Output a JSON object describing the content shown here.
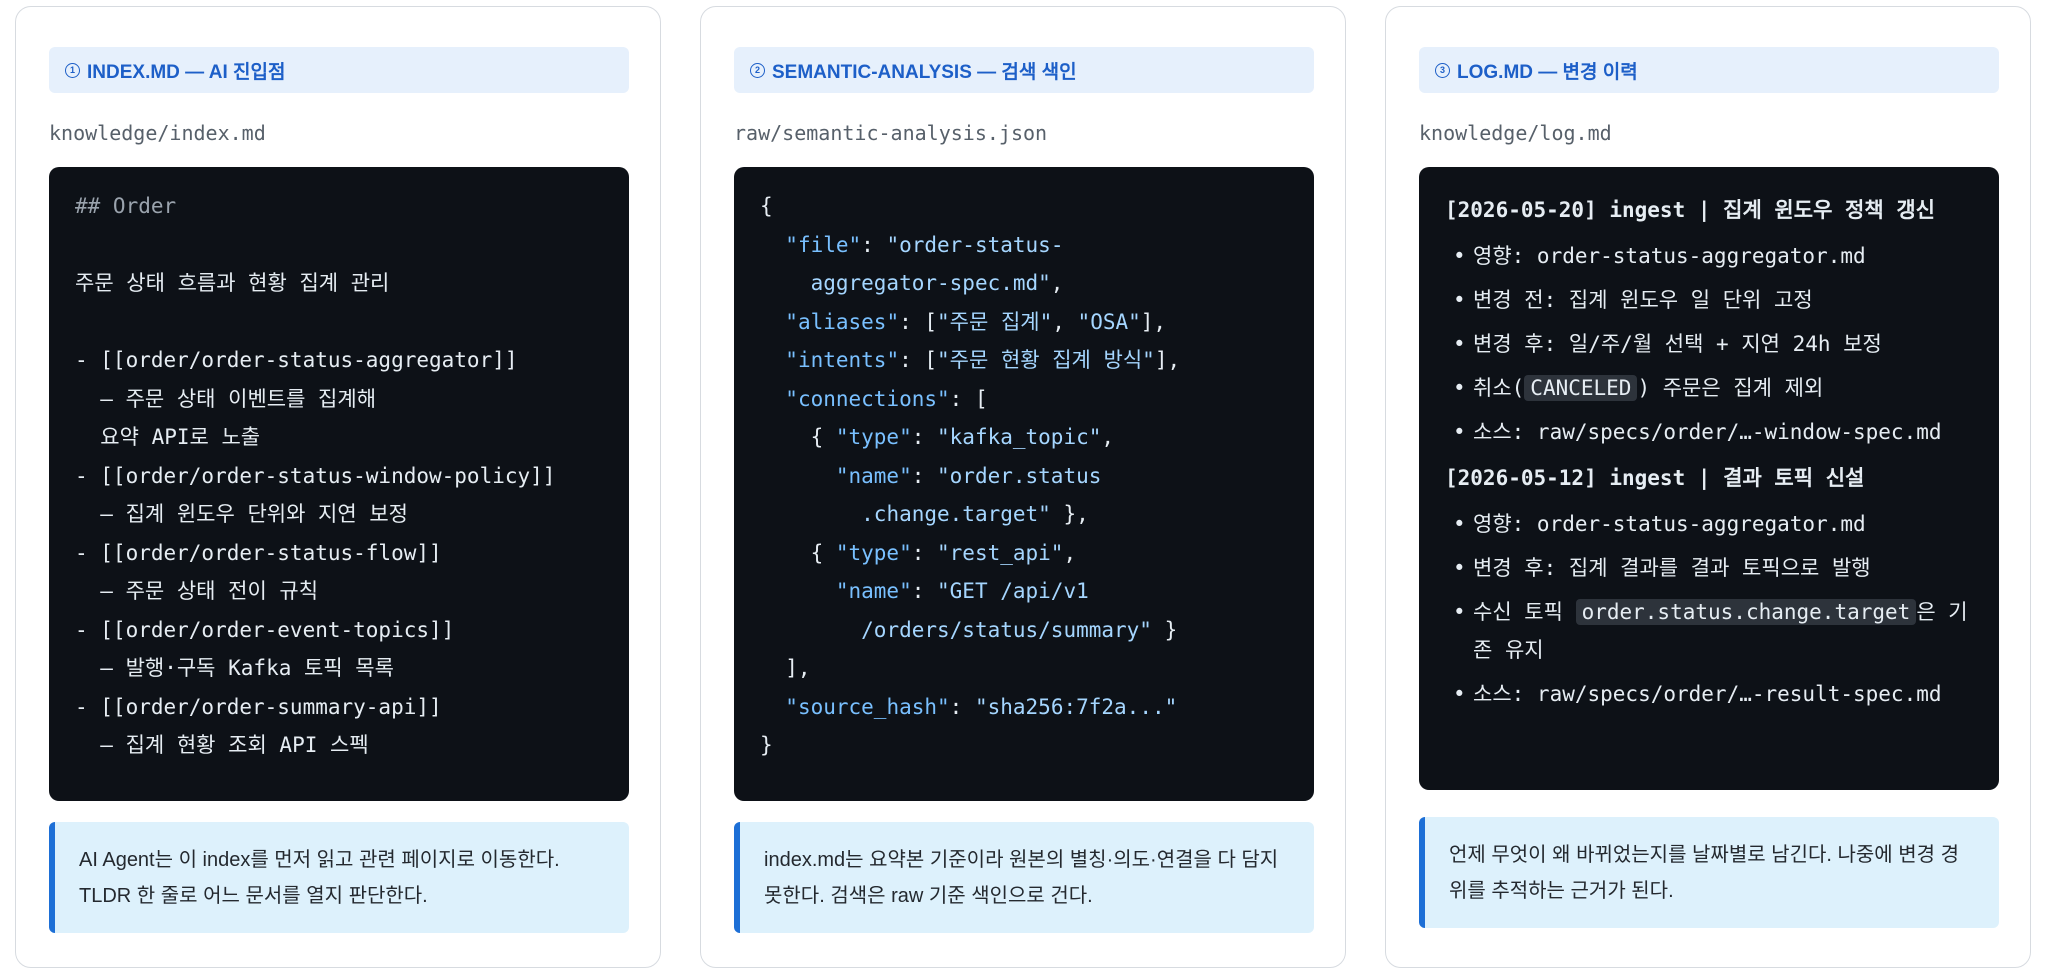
{
  "cards": [
    {
      "num": "1",
      "title": "INDEX.MD — AI 진입점",
      "path": "knowledge/index.md",
      "lines": [
        "## Order",
        "",
        "주문 상태 흐름과 현황 집계 관리",
        "",
        "- [[order/order-status-aggregator]]",
        "  — 주문 상태 이벤트를 집계해",
        "  요약 API로 노출",
        "- [[order/order-status-window-policy]]",
        "  — 집계 윈도우 단위와 지연 보정",
        "- [[order/order-status-flow]]",
        "  — 주문 상태 전이 규칙",
        "- [[order/order-event-topics]]",
        "  — 발행·구독 Kafka 토픽 목록",
        "- [[order/order-summary-api]]",
        "  — 집계 현황 조회 API 스펙"
      ],
      "note": "AI Agent는 이 index를 먼저 읽고 관련 페이지로 이동한다. TLDR 한 줄로 어느 문서를 열지 판단한다."
    },
    {
      "num": "2",
      "title": "SEMANTIC-ANALYSIS — 검색 색인",
      "path": "raw/semantic-analysis.json",
      "json": {
        "l1": "{",
        "file_key": "\"file\"",
        "file_val_a": "\"order-status-",
        "file_val_b": "aggregator-spec.md\"",
        "aliases_key": "\"aliases\"",
        "aliases_a": "\"주문 집계\"",
        "aliases_b": "\"OSA\"",
        "intents_key": "\"intents\"",
        "intents_a": "\"주문 현황 집계 방식\"",
        "connections_key": "\"connections\"",
        "type_key": "\"type\"",
        "type1": "\"kafka_topic\"",
        "name_key": "\"name\"",
        "name1_a": "\"order.status",
        "name1_b": ".change.target\"",
        "type2": "\"rest_api\"",
        "name2_a": "\"GET /api/v1",
        "name2_b": "/orders/status/summary\"",
        "hash_key": "\"source_hash\"",
        "hash_val": "\"sha256:7f2a...\"",
        "close": "}"
      },
      "note": "index.md는 요약본 기준이라 원본의 별칭·의도·연결을 다 담지 못한다. 검색은 raw 기준 색인으로 건다."
    },
    {
      "num": "3",
      "title": "LOG.MD — 변경 이력",
      "path": "knowledge/log.md",
      "entries": [
        {
          "head": "[2026-05-20] ingest | 집계 윈도우 정책 갱신",
          "items": [
            {
              "text": "영향: order-status-aggregator.md"
            },
            {
              "text": "변경 전: 집계 윈도우 일 단위 고정"
            },
            {
              "text": "변경 후: 일/주/월 선택 + 지연 24h 보정"
            },
            {
              "pre": "취소(",
              "chip": "CANCELED",
              "post": ") 주문은 집계 제외"
            },
            {
              "text": "소스: raw/specs/order/…-window-spec.md"
            }
          ]
        },
        {
          "head": "[2026-05-12] ingest | 결과 토픽 신설",
          "items": [
            {
              "text": "영향: order-status-aggregator.md"
            },
            {
              "text": "변경 후: 집계 결과를 결과 토픽으로 발행"
            },
            {
              "pre": "수신 토픽 ",
              "chip": "order.status.change.target",
              "post": "은 기존 유지"
            },
            {
              "text": "소스: raw/specs/order/…-result-spec.md"
            }
          ]
        }
      ],
      "note": "언제 무엇이 왜 바뀌었는지를 날짜별로 남긴다. 나중에 변경 경위를 추적하는 근거가 된다."
    }
  ]
}
